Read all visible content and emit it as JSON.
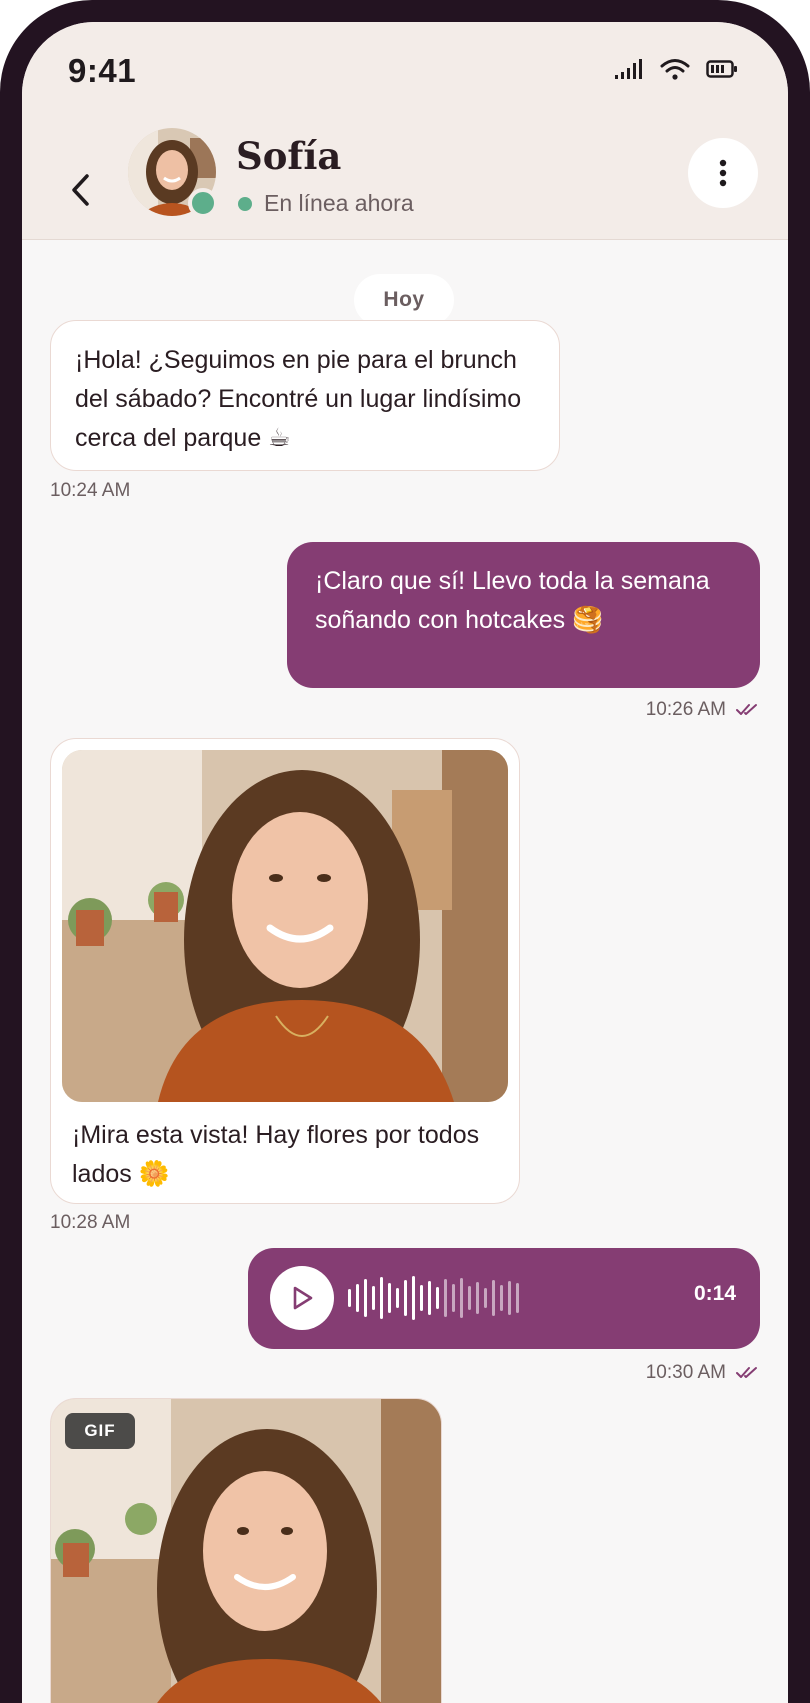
{
  "status_bar": {
    "time": "9:41"
  },
  "header": {
    "contact_name": "Sofía",
    "presence": "En línea ahora"
  },
  "chat": {
    "day_label": "Hoy",
    "messages": [
      {
        "text": "¡Hola! ¿Seguimos en pie para el brunch del sábado? Encontré un lugar lindísimo cerca del parque ☕",
        "time": "10:24 AM"
      },
      {
        "text": "¡Claro que sí! Llevo toda la semana soñando con hotcakes 🥞",
        "time": "10:26 AM"
      },
      {
        "caption": "¡Mira esta vista! Hay flores por todos lados 🌼",
        "time": "10:28 AM"
      },
      {
        "duration": "0:14",
        "time": "10:30 AM"
      },
      {
        "badge": "GIF"
      }
    ]
  },
  "colors": {
    "accent": "#853d73",
    "online": "#5dae8b",
    "header_bg": "#f3ece8"
  }
}
